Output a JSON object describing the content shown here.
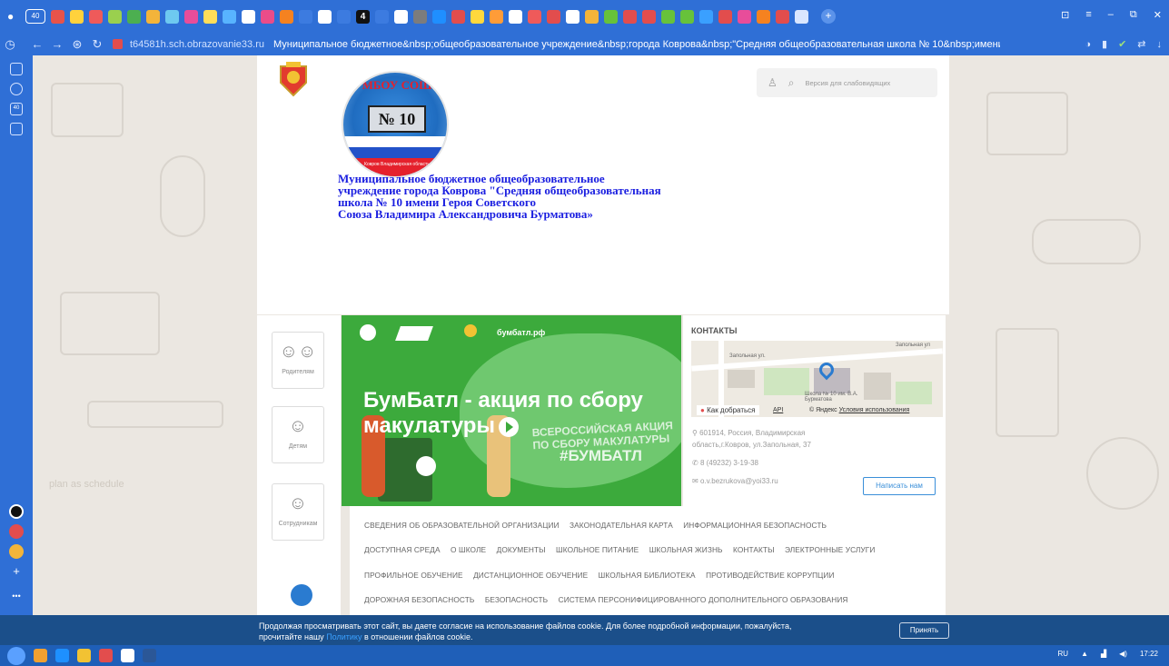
{
  "browser": {
    "tab_count": "40",
    "url_host": "t64581h.sch.obrazovanie33.ru",
    "page_title": "Муниципальное бюджетное&nbsp;общеобразовательное учреждение&nbsp;города Коврова&nbsp;\"Средняя общеобразовательная школа № 10&nbsp;имени...",
    "tab_label_4": "4",
    "side_badge": "40",
    "side_more": "•••",
    "colors": {
      "chrome": "#2f6fd6",
      "cookie_bar": "#1b4f8a"
    }
  },
  "header": {
    "logo_arc_text": "МБОУ СОШ",
    "logo_number": "№ 10",
    "logo_caption": "Ковров Владимирская область",
    "school_name_l1": "Муниципальное бюджетное общеобразовательное",
    "school_name_l2": "учреждение города Коврова \"Средняя общеобразовательная",
    "school_name_l3": "школа № 10 имени Героя Советского",
    "school_name_l4": "Союза Владимира Александровича Бурматова»",
    "accessibility_label": "Версия для слабовидящих"
  },
  "roles": [
    {
      "label": "Родителям",
      "icon": "parents-icon"
    },
    {
      "label": "Детям",
      "icon": "child-icon"
    },
    {
      "label": "Сотрудникам",
      "icon": "staff-icon"
    }
  ],
  "banner": {
    "site": "бумбатл.рф",
    "headline": "БумБатл - акция по сбору макулатуры",
    "action_text": "ВСЕРОССИЙСКАЯ АКЦИЯ ПО СБОРУ МАКУЛАТУРЫ",
    "hashtag": "#БУМБАТЛ"
  },
  "contacts": {
    "heading": "КОНТАКТЫ",
    "map_street": "Запольная ул.",
    "map_street2": "Запольная ул",
    "map_school": "Школа № 10 им. В.А. Бурматова",
    "map_how": "Как добраться",
    "map_api": "API",
    "map_yandex": "© Яндекс",
    "map_terms": "Условия использования",
    "address_l1": "601914, Россия, Владимирская",
    "address_l2": "область,г.Ковров, ул.Запольная, 37",
    "phone": "8 (49232) 3-19-38",
    "email": "o.v.bezrukova@yoi33.ru",
    "write_button": "Написать нам"
  },
  "menu": {
    "row1": [
      "СВЕДЕНИЯ ОБ ОБРАЗОВАТЕЛЬНОЙ ОРГАНИЗАЦИИ",
      "ЗАКОНОДАТЕЛЬНАЯ КАРТА",
      "ИНФОРМАЦИОННАЯ БЕЗОПАСНОСТЬ"
    ],
    "row2": [
      "ДОСТУПНАЯ СРЕДА",
      "О ШКОЛЕ",
      "ДОКУМЕНТЫ",
      "ШКОЛЬНОЕ ПИТАНИЕ",
      "ШКОЛЬНАЯ ЖИЗНЬ",
      "КОНТАКТЫ",
      "ЭЛЕКТРОННЫЕ УСЛУГИ"
    ],
    "row3": [
      "ПРОФИЛЬНОЕ ОБУЧЕНИЕ",
      "ДИСТАНЦИОННОЕ ОБУЧЕНИЕ",
      "ШКОЛЬНАЯ БИБЛИОТЕКА",
      "ПРОТИВОДЕЙСТВИЕ КОРРУПЦИИ"
    ],
    "row4": [
      "ДОРОЖНАЯ БЕЗОПАСНОСТЬ",
      "БЕЗОПАСНОСТЬ",
      "СИСТЕМА ПЕРСОНИФИЦИРОВАННОГО ДОПОЛНИТЕЛЬНОГО ОБРАЗОВАНИЯ"
    ]
  },
  "cookie": {
    "text_part1": "Продолжая просматривать этот сайт, вы даете согласие на использование файлов cookie. Для более подробной информации, пожалуйста,",
    "text_part2": "прочитайте нашу",
    "link": "Политику",
    "text_part3": "в отношении файлов cookie.",
    "accept": "Принять"
  },
  "taskbar": {
    "lang": "RU",
    "time": "17:22"
  },
  "doodle": {
    "blackboard_text": "plan as schedule"
  }
}
